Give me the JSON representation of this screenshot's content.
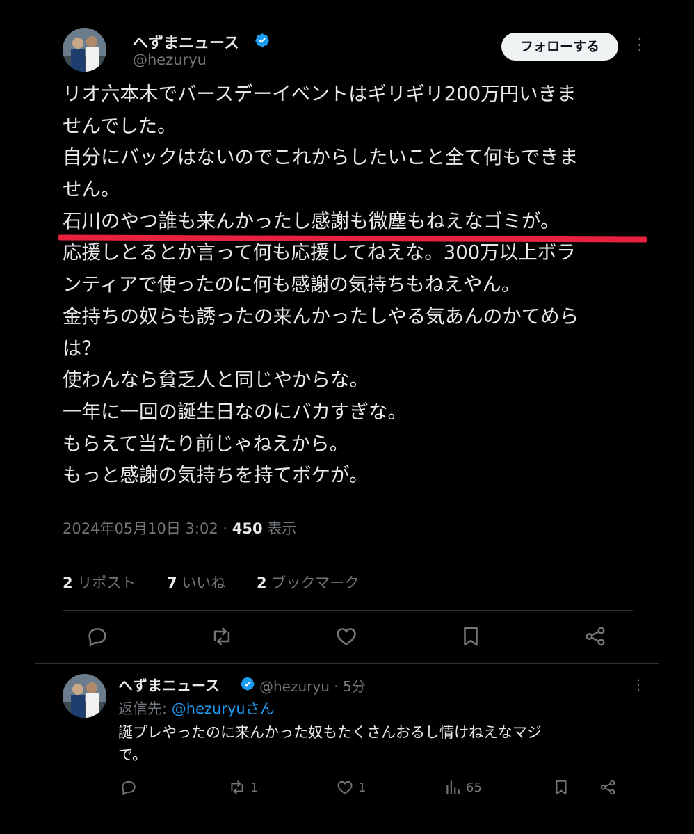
{
  "tweet": {
    "author_name": "へずまニュース",
    "author_handle": "@hezuryu",
    "follow_label": "フォローする",
    "body_lines": [
      "リオ六本木でバースデーイベントはギリギリ200万円いきま",
      "せんでした。",
      "自分にバックはないのでこれからしたいこと全て何もできま",
      "せん。",
      "石川のやつ誰も来んかったし感謝も微塵もねえなゴミが。",
      "応援しとるとか言って何も応援してねえな。300万以上ボラ",
      "ンティアで使ったのに何も感謝の気持ちもねえやん。",
      "金持ちの奴らも誘ったの来んかったしやる気あんのかてめら",
      "は？",
      "使わんなら貧乏人と同じやからな。",
      "一年に一回の誕生日なのにバカすぎな。",
      "もらえて当たり前じゃねえから。",
      "もっと感謝の気持ちを持てボケが。"
    ],
    "timestamp": "2024年05月10日 3:02",
    "views_count": "450",
    "views_label": "表示",
    "stats": {
      "reposts_count": "2",
      "reposts_label": "リポスト",
      "likes_count": "7",
      "likes_label": "いいね",
      "bookmarks_count": "2",
      "bookmarks_label": "ブックマーク"
    },
    "actions": [
      "reply-icon",
      "repost-icon",
      "like-icon",
      "bookmark-icon",
      "share-icon"
    ]
  },
  "reply": {
    "author_name": "へずまニュース",
    "author_handle": "@hezuryu",
    "time": "· 5分",
    "reply_to_label": "返信先:",
    "reply_to_handle": "@hezuryuさん",
    "body_lines": [
      "誕プレやったのに来んかった奴もたくさんおるし情けねえなマジ",
      "で。"
    ],
    "reposts": "1",
    "likes": "1",
    "views": "65"
  },
  "colors": {
    "background": "#000000",
    "text": "#e7e9ea",
    "muted": "#71767b",
    "accent": "#1d9bf0",
    "highlight_underline": "#e8213f"
  }
}
